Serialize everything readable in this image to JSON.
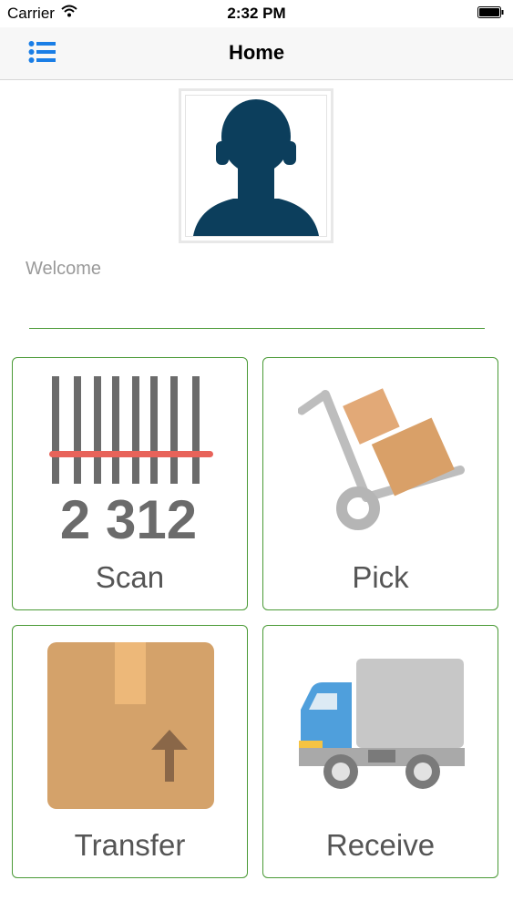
{
  "status_bar": {
    "carrier": "Carrier",
    "time": "2:32 PM"
  },
  "nav": {
    "title": "Home",
    "menu_icon": "list-icon",
    "accent_color": "#1a7ee6"
  },
  "profile": {
    "avatar_icon": "person-silhouette-icon",
    "avatar_color": "#0c3e5c"
  },
  "welcome": {
    "placeholder": "Welcome",
    "value": ""
  },
  "tiles": [
    {
      "label": "Scan",
      "icon": "barcode-icon",
      "barcode_digits": "2 312"
    },
    {
      "label": "Pick",
      "icon": "hand-truck-icon"
    },
    {
      "label": "Transfer",
      "icon": "package-upload-icon"
    },
    {
      "label": "Receive",
      "icon": "delivery-truck-icon"
    }
  ],
  "colors": {
    "tile_border": "#4a9a36",
    "scan_line": "#e8635a",
    "box": "#d4a26a",
    "truck_cab": "#4f9fdc"
  }
}
